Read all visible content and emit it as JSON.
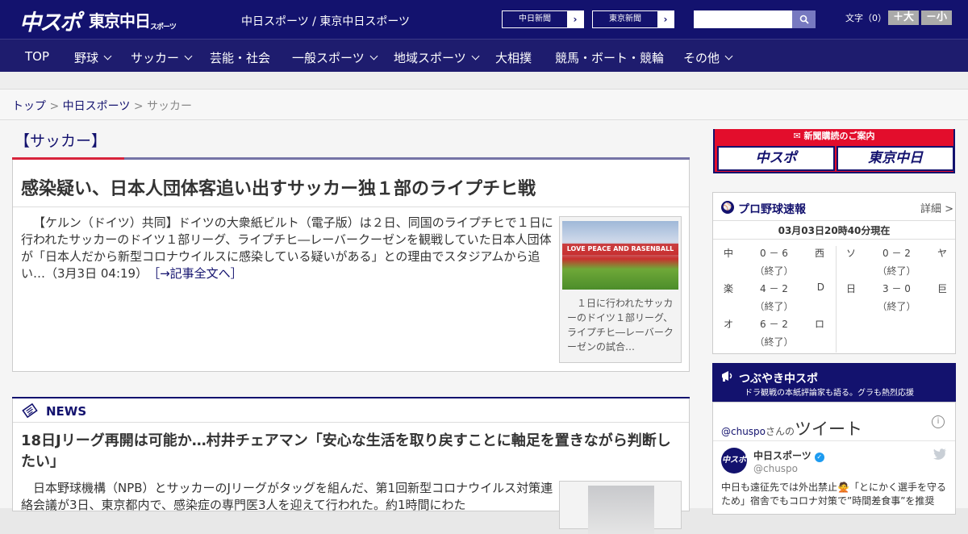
{
  "header": {
    "logo_chuspo": "中スポ",
    "logo_tokyo": "東京中日",
    "logo_tokyo_sub": "スポーツ",
    "site_title": "中日スポーツ / 東京中日スポーツ",
    "paper_links": [
      {
        "label": "中日新聞",
        "arrow": "›"
      },
      {
        "label": "東京新聞",
        "arrow": "›"
      }
    ],
    "search": {
      "placeholder": "",
      "icon": "search-icon"
    },
    "font_size": {
      "label": "文字（0）",
      "bigger": "＋大",
      "smaller": "－小"
    }
  },
  "nav": {
    "items": [
      {
        "label": "TOP",
        "dropdown": false
      },
      {
        "label": "野球",
        "dropdown": true
      },
      {
        "label": "サッカー",
        "dropdown": true
      },
      {
        "label": "芸能・社会",
        "dropdown": false
      },
      {
        "label": "一般スポーツ",
        "dropdown": true
      },
      {
        "label": "地域スポーツ",
        "dropdown": true
      },
      {
        "label": "大相撲",
        "dropdown": false
      },
      {
        "label": "競馬・ボート・競輪",
        "dropdown": false
      },
      {
        "label": "その他",
        "dropdown": true
      }
    ]
  },
  "breadcrumb": {
    "items": [
      "トップ",
      "中日スポーツ",
      "サッカー"
    ],
    "separator": ">"
  },
  "category": {
    "title": "【サッカー】"
  },
  "lead_article": {
    "title": "感染疑い、日本人団体客追い出すサッカー独１部のライプチヒ戦",
    "body": "【ケルン（ドイツ）共同】ドイツの大衆紙ビルト（電子版）は２日、同国のライプチヒで１日に行われたサッカーのドイツ１部リーグ、ライプチヒ―レーバークーゼンを観戦していた日本人団体が「日本人だから新型コロナウイルスに感染している疑いがある」との理由でスタジアムから追い…（3月3日 04:19）",
    "more_link": "［→記事全文へ］",
    "photo_banner": "LOVE PEACE AND RASENBALL",
    "caption": "１日に行われたサッカーのドイツ１部リーグ、ライプチヒ―レーバークーゼンの試合…"
  },
  "news": {
    "label": "NEWS",
    "title": "18日Jリーグ再開は可能か…村井チェアマン「安心な生活を取り戻すことに軸足を置きながら判断したい」",
    "body": "日本野球機構（NPB）とサッカーのJリーグがタッグを組んだ、第1回新型コロナウイルス対策連絡会議が3日、東京都内で、感染症の専門医3人を迎えて行われた。約1時間にわた"
  },
  "sidebar": {
    "subscribe": {
      "head": "新聞購読のご案内",
      "logos": [
        "中スポ",
        "東京中日"
      ]
    },
    "baseball": {
      "title": "プロ野球速報",
      "more": "詳細 >",
      "time": "03月03日20時40分現在",
      "left_games": [
        {
          "home": "中",
          "score": "0 － 6",
          "away": "西",
          "status": "（終了）"
        },
        {
          "home": "楽",
          "score": "4 － 2",
          "away": "D",
          "status": "（終了）"
        },
        {
          "home": "オ",
          "score": "6 － 2",
          "away": "ロ",
          "status": "（終了）"
        }
      ],
      "right_games": [
        {
          "home": "ソ",
          "score": "0 － 2",
          "away": "ヤ",
          "status": "（終了）"
        },
        {
          "home": "日",
          "score": "3 － 0",
          "away": "巨",
          "status": "（終了）"
        }
      ]
    },
    "tweets": {
      "title": "つぶやき中スポ",
      "subtitle": "ドラ観戦の本紙評論家も語る。グラも熱烈応援",
      "handle_link": "@chuspo",
      "handle_suffix": "さんの",
      "heading": "ツイート",
      "account_name": "中日スポーツ",
      "account_handle": "@chuspo",
      "avatar_text": "中スポ",
      "text": "中日も遠征先では外出禁止🙅「とにかく選手を守るため」宿舎でもコロナ対策で”時間差食事”を推奨"
    }
  },
  "colors": {
    "brand_navy": "#13126e",
    "accent_red": "#d8243c"
  }
}
